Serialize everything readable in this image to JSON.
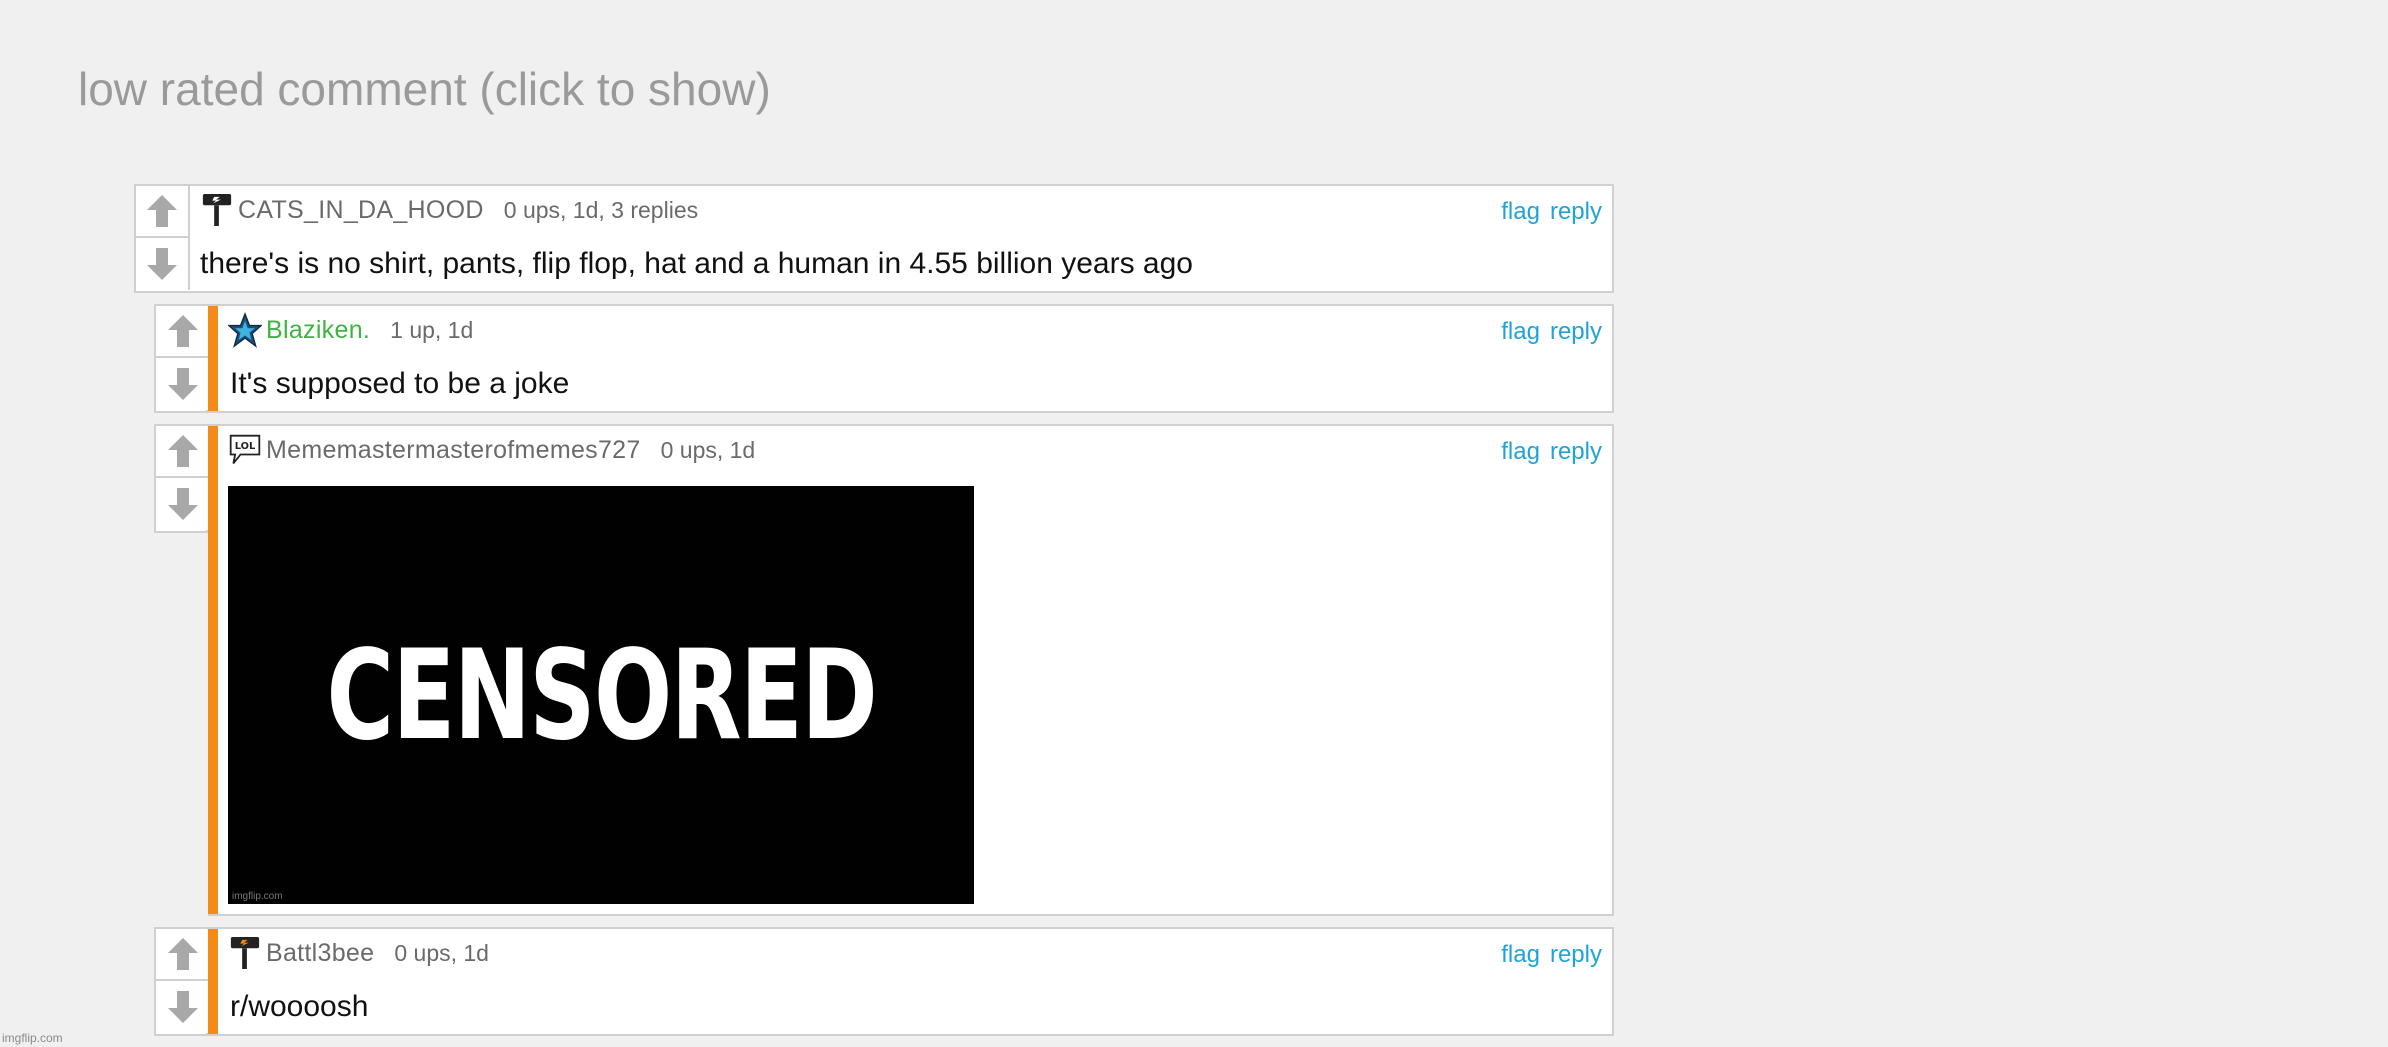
{
  "low_rated": {
    "text": "low rated comment (click to show)"
  },
  "comments": [
    {
      "username": "CATS_IN_DA_HOOD",
      "meta": "0 ups, 1d, 3 replies",
      "text": "there's is no shirt, pants, flip flop, hat and a human in 4.55 billion years ago",
      "icon": "hammer-flag-icon",
      "username_color": "#6a6a6a"
    },
    {
      "username": "Blaziken.",
      "meta": "1 up, 1d",
      "text": "It's supposed to be a joke",
      "icon": "star-icon",
      "username_color": "#3fb33f"
    },
    {
      "username": "Mememastermasterofmemes727",
      "meta": "0 ups, 1d",
      "image_text": "CENSORED",
      "image_watermark": "imgflip.com",
      "icon": "lol-speech-bubble-icon",
      "username_color": "#6a6a6a"
    },
    {
      "username": "Battl3bee",
      "meta": "0 ups, 1d",
      "text": "r/woooosh",
      "icon": "hammer-flag-icon",
      "username_color": "#6a6a6a"
    }
  ],
  "actions": {
    "flag": "flag",
    "reply": "reply"
  },
  "colors": {
    "accent_orange": "#f48a17",
    "link_blue": "#1fa3d8",
    "green_user": "#3fb33f",
    "background": "#f0f0f0"
  },
  "footer": {
    "watermark": "imgflip.com"
  }
}
